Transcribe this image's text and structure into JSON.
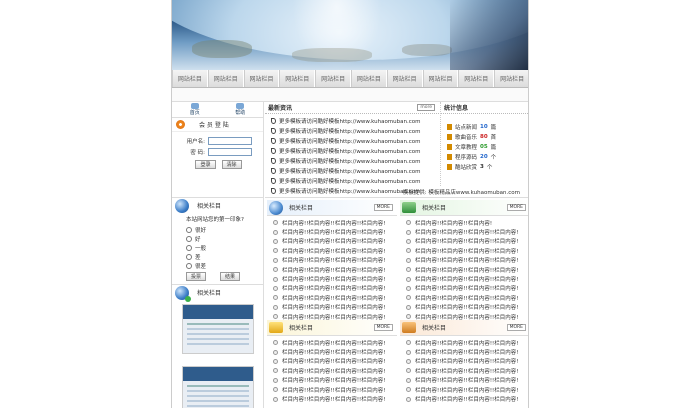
{
  "nav": {
    "items": [
      "网站栏目",
      "网站栏目",
      "网站栏目",
      "网站栏目",
      "网站栏目",
      "网站栏目",
      "网站栏目",
      "网站栏目",
      "网站栏目",
      "网站栏目"
    ]
  },
  "quick": {
    "home": "首页",
    "help": "帮助"
  },
  "login": {
    "title": "会 员 登 陆",
    "username_label": "用户名:",
    "password_label": "密    码:",
    "login_button": "登录",
    "clear_button": "清除"
  },
  "poll": {
    "title": "相关栏目",
    "question": "本站网站您的第一印象?",
    "options": [
      "很好",
      "好",
      "一般",
      "差",
      "很差"
    ],
    "vote_button": "投票",
    "result_button": "结果"
  },
  "related2": {
    "title": "相关栏目"
  },
  "news": {
    "title": "最新资讯",
    "more": "more",
    "items": [
      "更多模板请访问酷好模板http://www.kuhaomuban.com",
      "更多模板请访问酷好模板http://www.kuhaomuban.com",
      "更多模板请访问酷好模板http://www.kuhaomuban.com",
      "更多模板请访问酷好模板http://www.kuhaomuban.com",
      "更多模板请访问酷好模板http://www.kuhaomuban.com",
      "更多模板请访问酷好模板http://www.kuhaomuban.com",
      "更多模板请访问酷好模板http://www.kuhaomuban.com",
      "更多模板请访问酷好模板http://www.kuhaomuban.com"
    ]
  },
  "stats": {
    "title": "统计信息",
    "rows": [
      {
        "label": "站点新闻",
        "value": "10",
        "unit": "篇",
        "color": "#2266cc"
      },
      {
        "label": "歌曲音乐",
        "value": "80",
        "unit": "首",
        "color": "#cc2222"
      },
      {
        "label": "文章教程",
        "value": "05",
        "unit": "篇",
        "color": "#2a9a2a"
      },
      {
        "label": "程序源码",
        "value": "20",
        "unit": "个",
        "color": "#2266cc"
      },
      {
        "label": "酷站欣赏",
        "value": "3",
        "unit": "个",
        "color": "#333333"
      }
    ]
  },
  "footnote": "模板提供: 模板精品店www.kuhaomuban.com",
  "columns": {
    "col1": {
      "title": "相关栏目",
      "more": "MORE",
      "items": [
        "栏目内容!!栏目内容!!栏目内容!!栏目内容!",
        "栏目内容!!栏目内容!!栏目内容!!栏目内容!",
        "栏目内容!!栏目内容!!栏目内容!!栏目内容!",
        "栏目内容!!栏目内容!!栏目内容!!栏目内容!",
        "栏目内容!!栏目内容!!栏目内容!!栏目内容!",
        "栏目内容!!栏目内容!!栏目内容!!栏目内容!",
        "栏目内容!!栏目内容!!栏目内容!!栏目内容!",
        "栏目内容!!栏目内容!!栏目内容!!栏目内容!",
        "栏目内容!!栏目内容!!栏目内容!!栏目内容!",
        "栏目内容!!栏目内容!!栏目内容!!栏目内容!",
        "栏目内容!!栏目内容!!栏目内容!!栏目内容!",
        "栏目内容!!栏目内容!!栏目内容!!栏目内容!"
      ]
    },
    "col2": {
      "title": "相关栏目",
      "more": "MORE",
      "items": [
        "栏目内容!!栏目内容!!栏目内容!",
        "栏目内容!!栏目内容!!栏目内容!!栏目内容!",
        "栏目内容!!栏目内容!!栏目内容!!栏目内容!",
        "栏目内容!!栏目内容!!栏目内容!!栏目内容!",
        "栏目内容!!栏目内容!!栏目内容!!栏目内容!",
        "栏目内容!!栏目内容!!栏目内容!!栏目内容!",
        "栏目内容!!栏目内容!!栏目内容!!栏目内容!",
        "栏目内容!!栏目内容!!栏目内容!!栏目内容!",
        "栏目内容!!栏目内容!!栏目内容!!栏目内容!",
        "栏目内容!!栏目内容!!栏目内容!!栏目内容!",
        "栏目内容!!栏目内容!!栏目内容!!栏目内容!",
        "栏目内容!!栏目内容!!栏目内容!!栏目内容!"
      ]
    },
    "col3": {
      "title": "相关栏目",
      "more": "MORE",
      "items": [
        "栏目内容!!栏目内容!!栏目内容!!栏目内容!",
        "栏目内容!!栏目内容!!栏目内容!!栏目内容!",
        "栏目内容!!栏目内容!!栏目内容!!栏目内容!",
        "栏目内容!!栏目内容!!栏目内容!!栏目内容!",
        "栏目内容!!栏目内容!!栏目内容!!栏目内容!",
        "栏目内容!!栏目内容!!栏目内容!!栏目内容!",
        "栏目内容!!栏目内容!!栏目内容!!栏目内容!"
      ]
    },
    "col4": {
      "title": "相关栏目",
      "more": "MORE",
      "items": [
        "栏目内容!!栏目内容!!栏目内容!!栏目内容!",
        "栏目内容!!栏目内容!!栏目内容!!栏目内容!",
        "栏目内容!!栏目内容!!栏目内容!!栏目内容!",
        "栏目内容!!栏目内容!!栏目内容!!栏目内容!",
        "栏目内容!!栏目内容!!栏目内容!!栏目内容!",
        "栏目内容!!栏目内容!!栏目内容!!栏目内容!",
        "栏目内容!!栏目内容!!栏目内容!!栏目内容!"
      ]
    }
  }
}
